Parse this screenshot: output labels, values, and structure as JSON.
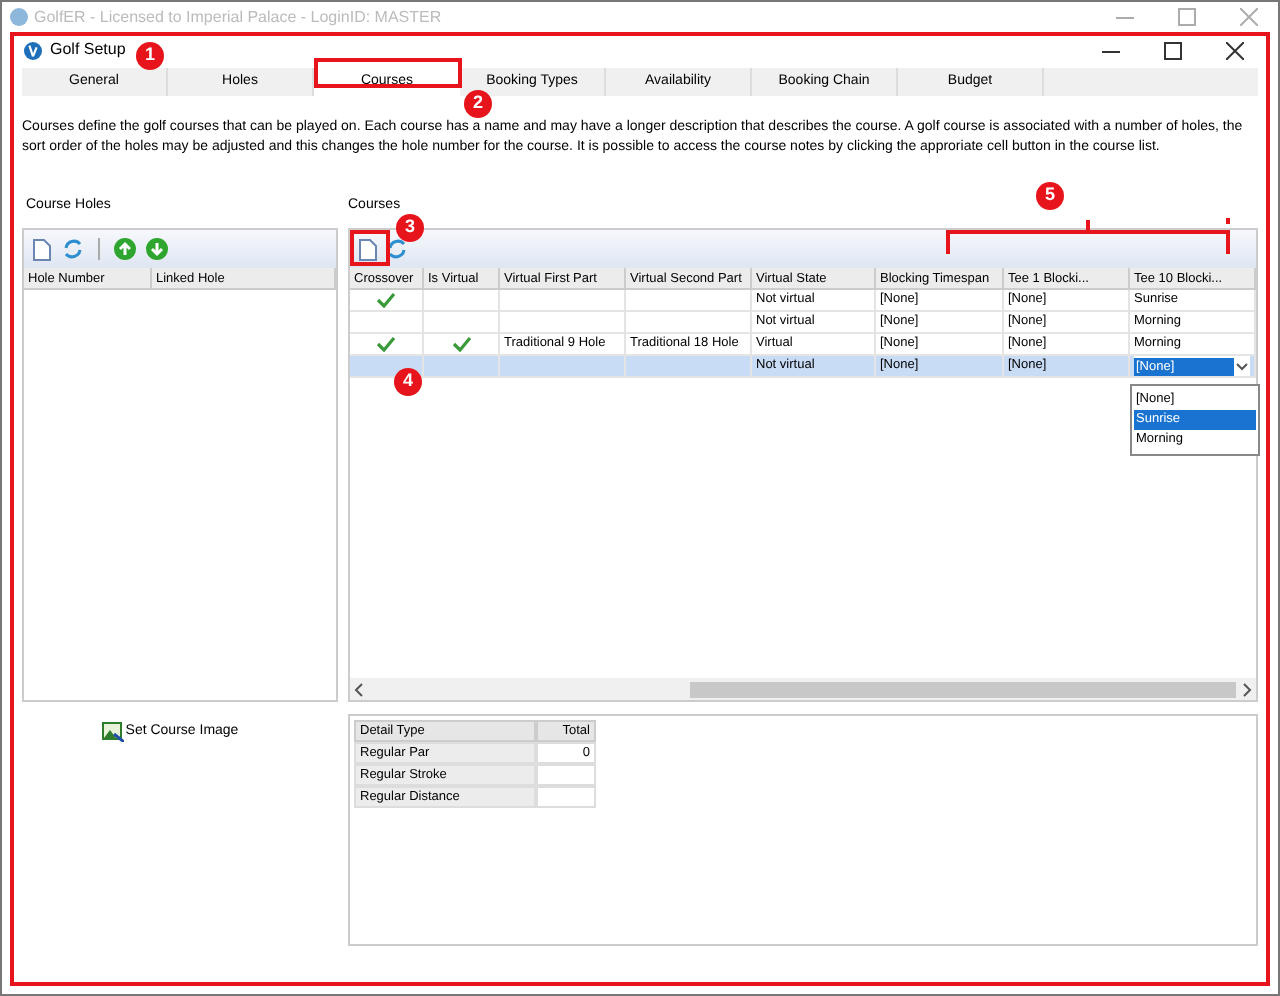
{
  "app_window": {
    "title": "GolfER - Licensed to Imperial Palace - LoginID: MASTER"
  },
  "window": {
    "title": "Golf Setup"
  },
  "tabs": [
    {
      "label": "General",
      "selected": false
    },
    {
      "label": "Holes",
      "selected": false
    },
    {
      "label": "Courses",
      "selected": true
    },
    {
      "label": "Booking Types",
      "selected": false
    },
    {
      "label": "Availability",
      "selected": false
    },
    {
      "label": "Booking Chain",
      "selected": false
    },
    {
      "label": "Budget",
      "selected": false
    }
  ],
  "description": "Courses define the golf courses that can be played on. Each course has a name and may have a longer description that describes the course. A golf course is associated with a number of holes, the sort order of the holes may be adjusted and this changes the hole number for the course. It is possible to access the course notes by clicking the approriate cell button in the course list.",
  "course_holes": {
    "title": "Course Holes",
    "columns": [
      "Hole Number",
      "Linked Hole"
    ]
  },
  "courses": {
    "title": "Courses",
    "columns": [
      "Crossover",
      "Is Virtual",
      "Virtual First Part",
      "Virtual Second Part",
      "Virtual State",
      "Blocking Timespan",
      "Tee 1 Blocki...",
      "Tee 10 Blocki..."
    ],
    "rows": [
      {
        "selected": false,
        "crossover": true,
        "is_virtual": false,
        "virtual_first_part": "",
        "virtual_second_part": "",
        "virtual_state": "Not virtual",
        "blocking_timespan": "[None]",
        "tee_1": "[None]",
        "tee_10": "Sunrise"
      },
      {
        "selected": false,
        "crossover": false,
        "is_virtual": false,
        "virtual_first_part": "",
        "virtual_second_part": "",
        "virtual_state": "Not virtual",
        "blocking_timespan": "[None]",
        "tee_1": "[None]",
        "tee_10": "Morning"
      },
      {
        "selected": false,
        "crossover": true,
        "is_virtual": true,
        "virtual_first_part": "Traditional 9 Hole",
        "virtual_second_part": "Traditional 18 Hole",
        "virtual_state": "Virtual",
        "blocking_timespan": "[None]",
        "tee_1": "[None]",
        "tee_10": "Morning"
      },
      {
        "selected": true,
        "crossover": false,
        "is_virtual": false,
        "virtual_first_part": "",
        "virtual_second_part": "",
        "virtual_state": "Not virtual",
        "blocking_timespan": "[None]",
        "tee_1": "[None]",
        "tee_10": "[None]"
      }
    ],
    "dropdown_options": [
      {
        "label": "[None]",
        "selected": false
      },
      {
        "label": "Sunrise",
        "selected": true
      },
      {
        "label": "Morning",
        "selected": false
      }
    ]
  },
  "set_course_image": "Set Course Image",
  "details": {
    "columns": [
      "Detail Type",
      "Total"
    ],
    "rows": [
      {
        "type": "Regular Par",
        "total": "0"
      },
      {
        "type": "Regular Stroke",
        "total": ""
      },
      {
        "type": "Regular Distance",
        "total": ""
      }
    ]
  },
  "callouts": [
    "1",
    "2",
    "3",
    "4",
    "5"
  ]
}
